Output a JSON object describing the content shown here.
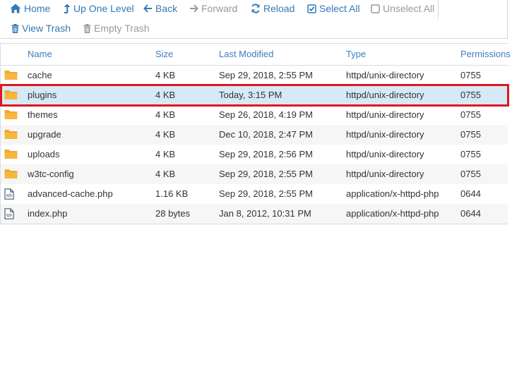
{
  "toolbar": {
    "home": "Home",
    "up_one_level": "Up One Level",
    "back": "Back",
    "forward": "Forward",
    "reload": "Reload",
    "select_all": "Select All",
    "unselect_all": "Unselect All",
    "view_trash": "View Trash",
    "empty_trash": "Empty Trash"
  },
  "columns": {
    "name": "Name",
    "size": "Size",
    "last_modified": "Last Modified",
    "type": "Type",
    "permissions": "Permissions"
  },
  "files": [
    {
      "icon": "folder-icon",
      "name": "cache",
      "size": "4 KB",
      "modified": "Sep 29, 2018, 2:55 PM",
      "type": "httpd/unix-directory",
      "perms": "0755"
    },
    {
      "icon": "folder-icon",
      "name": "plugins",
      "size": "4 KB",
      "modified": "Today, 3:15 PM",
      "type": "httpd/unix-directory",
      "perms": "0755"
    },
    {
      "icon": "folder-icon",
      "name": "themes",
      "size": "4 KB",
      "modified": "Sep 26, 2018, 4:19 PM",
      "type": "httpd/unix-directory",
      "perms": "0755"
    },
    {
      "icon": "folder-icon",
      "name": "upgrade",
      "size": "4 KB",
      "modified": "Dec 10, 2018, 2:47 PM",
      "type": "httpd/unix-directory",
      "perms": "0755"
    },
    {
      "icon": "folder-icon",
      "name": "uploads",
      "size": "4 KB",
      "modified": "Sep 29, 2018, 2:56 PM",
      "type": "httpd/unix-directory",
      "perms": "0755"
    },
    {
      "icon": "folder-icon",
      "name": "w3tc-config",
      "size": "4 KB",
      "modified": "Sep 29, 2018, 2:55 PM",
      "type": "httpd/unix-directory",
      "perms": "0755"
    },
    {
      "icon": "code-file-icon",
      "name": "advanced-cache.php",
      "size": "1.16 KB",
      "modified": "Sep 29, 2018, 2:55 PM",
      "type": "application/x-httpd-php",
      "perms": "0644"
    },
    {
      "icon": "code-file-icon",
      "name": "index.php",
      "size": "28 bytes",
      "modified": "Jan 8, 2012, 10:31 PM",
      "type": "application/x-httpd-php",
      "perms": "0644"
    }
  ],
  "selected_file": "plugins",
  "colors": {
    "link": "#337ab7",
    "disabled": "#999999",
    "folder": "#f0a830",
    "selected_row": "#d6e9f7",
    "highlight_border": "#e0161f"
  }
}
